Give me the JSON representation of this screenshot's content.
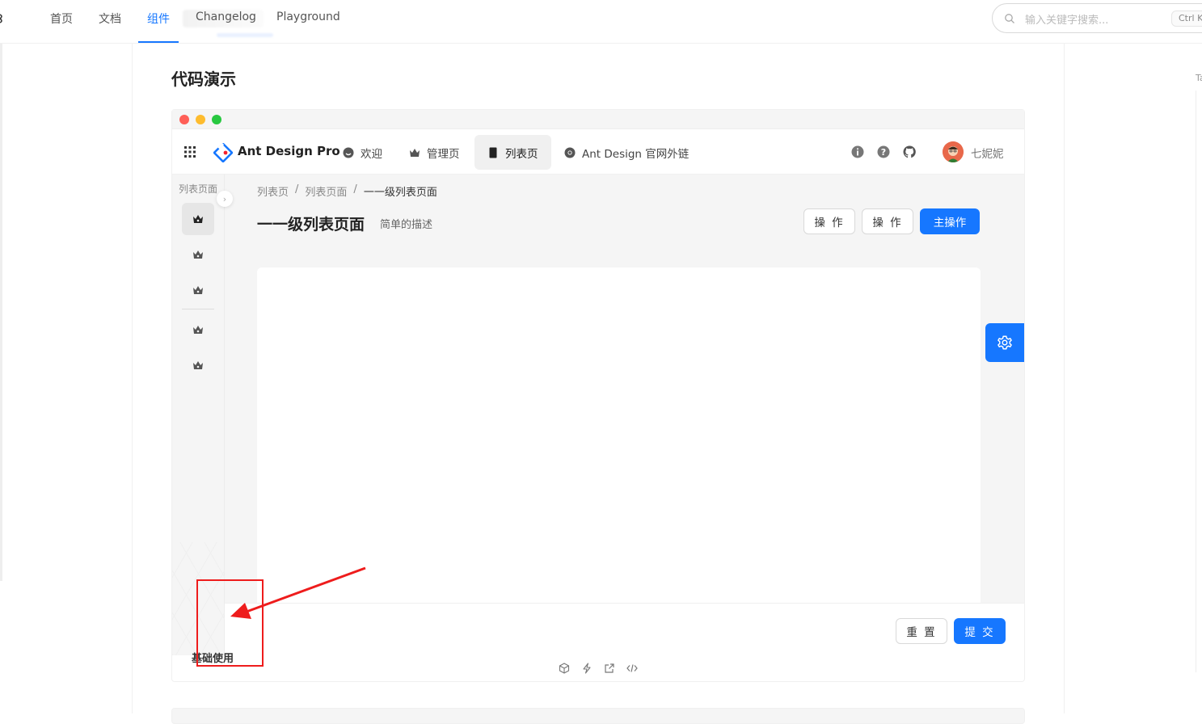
{
  "topnav": {
    "items": [
      {
        "label": "首页"
      },
      {
        "label": "文档"
      },
      {
        "label": "组件",
        "active": true
      },
      {
        "label": "Changelog"
      },
      {
        "label": "Playground"
      }
    ],
    "search_placeholder": "输入关键字搜索...",
    "search_shortcut": "Ctrl K"
  },
  "page": {
    "title": "代码演示"
  },
  "right_rail_fragment": "Ta",
  "demo": {
    "app": {
      "brand": "Ant Design Pro",
      "menu": [
        {
          "label": "欢迎",
          "icon": "smile-icon"
        },
        {
          "label": "管理页",
          "icon": "crown-icon"
        },
        {
          "label": "列表页",
          "icon": "tablet-icon",
          "selected": true
        },
        {
          "label": "Ant Design 官网外链",
          "icon": "chrome-icon"
        }
      ],
      "user_name": "七妮妮",
      "sider": {
        "title": "列表页面",
        "items": [
          "crown-icon",
          "crown-icon",
          "crown-icon",
          "crown-icon",
          "crown-icon"
        ]
      },
      "breadcrumb": [
        "列表页",
        "列表页面",
        "一一级列表页面"
      ],
      "page_header": {
        "title": "一一级列表页面",
        "description": "简单的描述"
      },
      "buttons": {
        "action1": "操 作",
        "action2": "操 作",
        "primary": "主操作"
      },
      "footer": {
        "reset": "重 置",
        "submit": "提 交"
      }
    },
    "title": "基础使用"
  },
  "colors": {
    "primary": "#1677ff",
    "annotation": "#ee1c1c"
  }
}
